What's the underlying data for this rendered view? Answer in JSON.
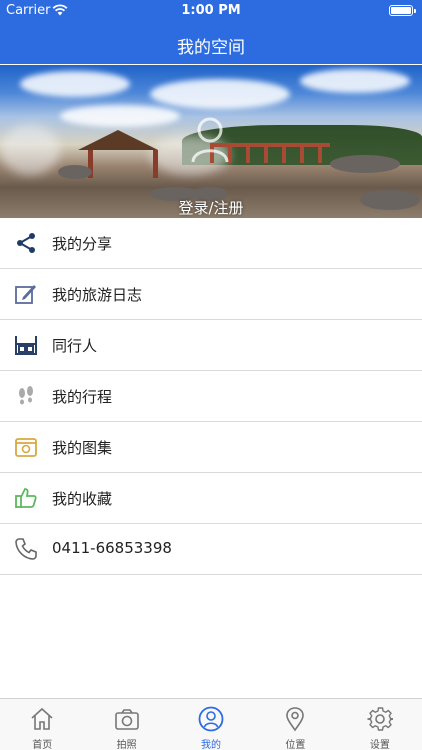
{
  "status_bar": {
    "carrier": "Carrier",
    "time": "1:00 PM",
    "battery_level": 1.0
  },
  "nav": {
    "title": "我的空间"
  },
  "banner": {
    "login_label": "登录/注册"
  },
  "menu": {
    "items": [
      {
        "label": "我的分享",
        "icon": "share-icon"
      },
      {
        "label": "我的旅游日志",
        "icon": "edit-icon"
      },
      {
        "label": "同行人",
        "icon": "companions-icon"
      },
      {
        "label": "我的行程",
        "icon": "footprints-icon"
      },
      {
        "label": "我的图集",
        "icon": "album-icon"
      },
      {
        "label": "我的收藏",
        "icon": "thumbs-up-icon"
      },
      {
        "label": "0411-66853398",
        "icon": "phone-icon"
      }
    ]
  },
  "tabbar": {
    "tabs": [
      {
        "label": "首页",
        "icon": "home-icon"
      },
      {
        "label": "拍照",
        "icon": "camera-icon"
      },
      {
        "label": "我的",
        "icon": "user-icon",
        "active": true
      },
      {
        "label": "位置",
        "icon": "location-pin-icon"
      },
      {
        "label": "设置",
        "icon": "gear-icon"
      }
    ]
  },
  "colors": {
    "accent": "#2d6be0",
    "tab_inactive": "#555555",
    "divider": "#d9d9d9"
  }
}
